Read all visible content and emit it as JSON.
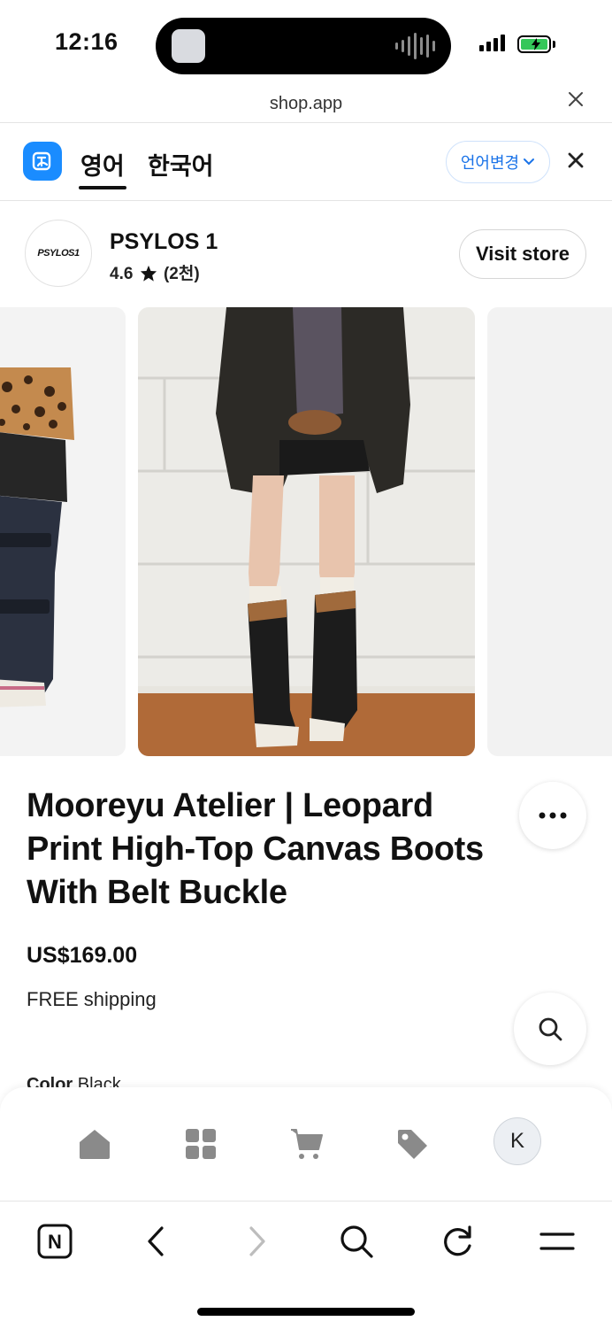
{
  "status_bar": {
    "time": "12:16"
  },
  "url_bar": {
    "url": "shop.app"
  },
  "translate_bar": {
    "tabs": [
      {
        "label": "영어",
        "active": true
      },
      {
        "label": "한국어",
        "active": false
      }
    ],
    "change_language_label": "언어변경"
  },
  "store": {
    "logo_text": "PSYLOS1",
    "name": "PSYLOS 1",
    "rating": "4.6",
    "review_count": "(2천)",
    "visit_label": "Visit store"
  },
  "product": {
    "title": "Mooreyu Atelier | Leopard Print High-Top Canvas Boots With Belt Buckle",
    "price": "US$169.00",
    "shipping": "FREE shipping",
    "color_label": "Color",
    "color_value": "Black"
  },
  "bottom_nav": {
    "items": [
      "home-icon",
      "categories-icon",
      "cart-icon",
      "tag-icon"
    ],
    "avatar_initial": "K"
  },
  "browser_toolbar": {
    "items": [
      "tab-icon",
      "back-icon",
      "forward-icon",
      "search-icon",
      "reload-icon",
      "menu-icon"
    ],
    "tab_letter": "N"
  },
  "colors": {
    "accent_blue": "#1a8cff",
    "battery_green": "#34c759"
  }
}
